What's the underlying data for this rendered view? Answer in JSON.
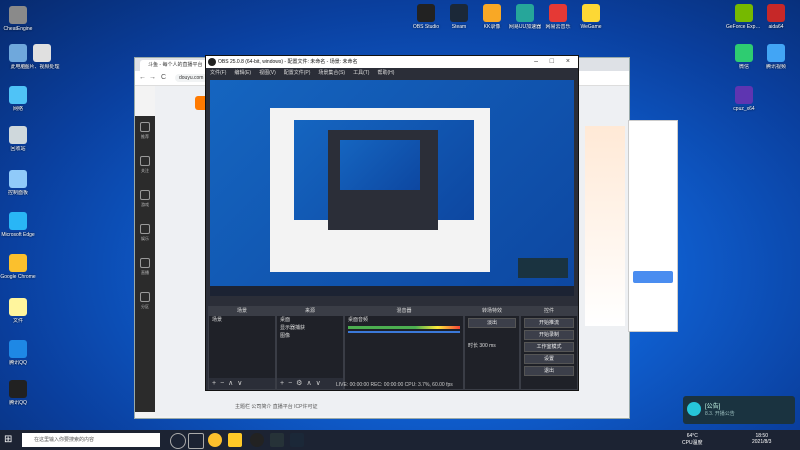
{
  "desktop_icons_left": [
    {
      "label": "CheatEngine",
      "color": "#8a8a8a"
    },
    {
      "label": "此电脑",
      "color": "#6fa8dc"
    },
    {
      "label": "图片、视频处理",
      "color": "#e0e0e0"
    },
    {
      "label": "网络",
      "color": "#4fc3f7"
    },
    {
      "label": "回收站",
      "color": "#cfd8dc"
    },
    {
      "label": "控制面板",
      "color": "#90caf9"
    },
    {
      "label": "Microsoft Edge",
      "color": "#29b6f6"
    },
    {
      "label": "Google Chrome",
      "color": "#fbc02d"
    },
    {
      "label": "文件",
      "color": "#fff59d"
    },
    {
      "label": "腾讯QQ",
      "color": "#1e88e5"
    },
    {
      "label": "腾讯QQ",
      "color": "#212121"
    }
  ],
  "desktop_icons_top": [
    {
      "label": "OBS Studio",
      "color": "#222222"
    },
    {
      "label": "Steam",
      "color": "#1b2838"
    },
    {
      "label": "KK录像",
      "color": "#f9a825"
    },
    {
      "label": "网易UU加速器",
      "color": "#26a69a"
    },
    {
      "label": "网易云音乐",
      "color": "#e53935"
    },
    {
      "label": "WeGame",
      "color": "#fdd835"
    }
  ],
  "desktop_icons_right": [
    {
      "label": "GeForce Experience",
      "color": "#76b900"
    },
    {
      "label": "aida64",
      "color": "#c62828"
    },
    {
      "label": "微信",
      "color": "#2ecc71"
    },
    {
      "label": "腾讯视频",
      "color": "#42a5f5"
    },
    {
      "label": "cpuz_x64",
      "color": "#5e35b1"
    }
  ],
  "browser": {
    "tab_title": "斗鱼 - 每个人的直播平台",
    "url": "douyu.com",
    "back": "←",
    "forward": "→",
    "reload": "C",
    "left_nav": [
      "推荐",
      "关注",
      "游戏",
      "娱乐",
      "直播",
      "分区"
    ],
    "status_text": "主题栏 公司简介 直播平台 ICP许可证"
  },
  "obs": {
    "title": "OBS 25.0.8 (64-bit, windows) - 配置文件: 未命名 - 场景: 未命名",
    "menu": [
      "文件(F)",
      "编辑(E)",
      "视图(V)",
      "配置文件(P)",
      "场景集合(S)",
      "工具(T)",
      "帮助(H)"
    ],
    "docks": {
      "scenes": {
        "title": "场景",
        "items": [
          "场景"
        ]
      },
      "sources": {
        "title": "来源",
        "items": [
          "桌面",
          "显示器捕获",
          "图像"
        ]
      },
      "mixer": {
        "title": "混音器",
        "items": [
          "桌面音频"
        ]
      },
      "transitions": {
        "title": "转场特效",
        "fade": "淡出",
        "duration_label": "时长",
        "duration_value": "300 ms"
      },
      "controls": {
        "title": "控件",
        "buttons": [
          "开始推流",
          "开始录制",
          "工作室模式",
          "设置",
          "退出"
        ]
      }
    },
    "statusbar": "LIVE: 00:00:00   REC: 00:00:00   CPU: 3.7%, 60.00 fps"
  },
  "right_panel": {
    "items": [
      "登录",
      "忘记密码",
      "注册"
    ]
  },
  "notification": {
    "title": "[公告]",
    "text": "8.3. 开播公告"
  },
  "taskbar": {
    "search_placeholder": "在这里输入你要搜索的内容",
    "temp": "64°C",
    "cpu_label": "CPU温度",
    "time": "18:50",
    "date": "2021/8/3"
  }
}
